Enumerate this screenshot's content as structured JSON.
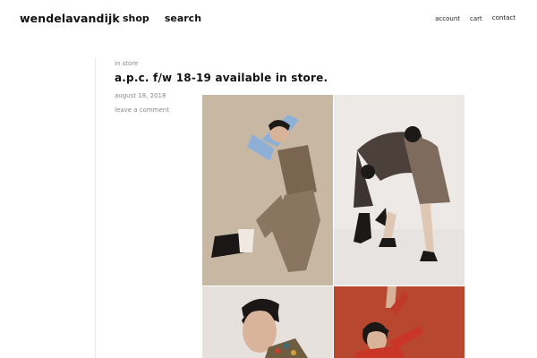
{
  "site": {
    "brand": "wendelavandijk"
  },
  "nav": {
    "shop": "shop",
    "search": "search"
  },
  "usernav": {
    "account": "account",
    "cart": "cart",
    "contact": "contact"
  },
  "post": {
    "category": "in store",
    "title": "a.p.c. f/w 18-19 available in store.",
    "date": "august 18, 2018",
    "comment_link": "leave a comment"
  },
  "colors": {
    "text": "#111111",
    "muted": "#8a8a8a",
    "rail": "#ececec",
    "photo_bg_1": "#cbbba6",
    "photo_bg_2": "#ede9e6",
    "photo_bg_3": "#e6e1dc",
    "photo_bg_4": "#b8472f"
  }
}
